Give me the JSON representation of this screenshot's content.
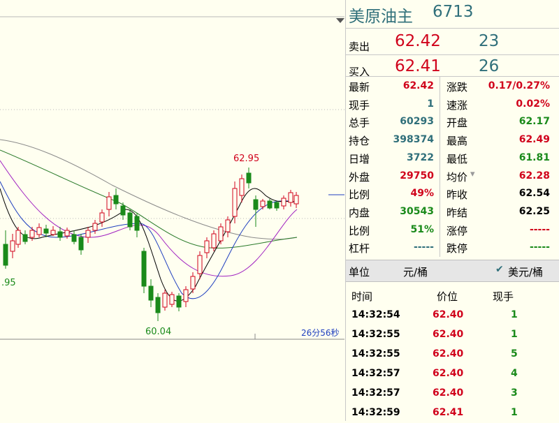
{
  "chart": {
    "high_label": "62.95",
    "low_label": "60.04",
    "left_label": ".95",
    "countdown": "26分56秒",
    "colors": {
      "up": "#d0021b",
      "down": "#1a8a1a",
      "ma1": "#000000",
      "ma2": "#1f3fbf",
      "ma3": "#a020c0",
      "ma4": "#2a7a2a",
      "ma5": "#8a8a8a"
    }
  },
  "quote": {
    "name": "美原油主",
    "code": "6713",
    "ask": {
      "label": "卖出",
      "price": "62.42",
      "volume": "23"
    },
    "bid": {
      "label": "买入",
      "price": "62.41",
      "volume": "26"
    },
    "stats": [
      {
        "k1": "最新",
        "v1": "62.42",
        "c1": "red",
        "k2": "涨跌",
        "v2": "0.17/0.27%",
        "c2": "red"
      },
      {
        "k1": "现手",
        "v1": "1",
        "c1": "teal",
        "k2": "速涨",
        "v2": "0.02%",
        "c2": "red"
      },
      {
        "k1": "总手",
        "v1": "60293",
        "c1": "teal",
        "k2": "开盘",
        "v2": "62.17",
        "c2": "grn"
      },
      {
        "k1": "持仓",
        "v1": "398374",
        "c1": "teal",
        "k2": "最高",
        "v2": "62.49",
        "c2": "red"
      },
      {
        "k1": "日增",
        "v1": "3722",
        "c1": "teal",
        "k2": "最低",
        "v2": "61.81",
        "c2": "grn"
      },
      {
        "k1": "外盘",
        "v1": "29750",
        "c1": "red",
        "k2": "均价",
        "v2": "62.28",
        "c2": "red"
      },
      {
        "k1": "比例",
        "v1": "49%",
        "c1": "red",
        "k2": "昨收",
        "v2": "62.54",
        "c2": "blk"
      },
      {
        "k1": "内盘",
        "v1": "30543",
        "c1": "grn",
        "k2": "昨结",
        "v2": "62.25",
        "c2": "blk"
      },
      {
        "k1": "比例",
        "v1": "51%",
        "c1": "grn",
        "k2": "涨停",
        "v2": "-----",
        "c2": "red"
      },
      {
        "k1": "杠杆",
        "v1": "-----",
        "c1": "teal",
        "k2": "跌停",
        "v2": "-----",
        "c2": "grn"
      }
    ],
    "unit": {
      "label": "单位",
      "value1": "元/桶",
      "check": "✔",
      "value2": "美元/桶"
    },
    "ticks_header": {
      "time": "时间",
      "price": "价位",
      "volume": "现手"
    },
    "ticks": [
      {
        "time": "14:32:54",
        "price": "62.40",
        "volume": "1"
      },
      {
        "time": "14:32:55",
        "price": "62.40",
        "volume": "1"
      },
      {
        "time": "14:32:55",
        "price": "62.40",
        "volume": "5"
      },
      {
        "time": "14:32:57",
        "price": "62.40",
        "volume": "4"
      },
      {
        "time": "14:32:57",
        "price": "62.40",
        "volume": "3"
      },
      {
        "time": "14:32:59",
        "price": "62.41",
        "volume": "1"
      }
    ]
  }
}
